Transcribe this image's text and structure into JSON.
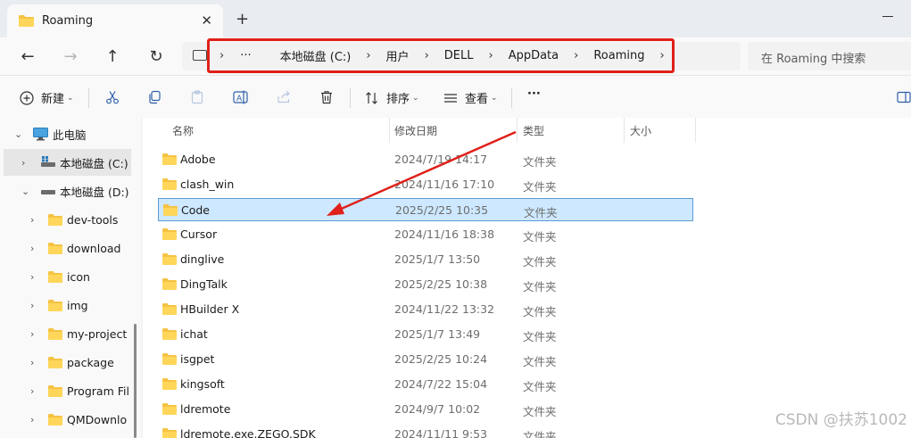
{
  "tab": {
    "title": "Roaming",
    "close": "✕",
    "new_tab": "+"
  },
  "nav": {
    "back": "←",
    "forward": "→",
    "up": "↑",
    "refresh": "↻"
  },
  "breadcrumb": {
    "overflow": "···",
    "items": [
      "本地磁盘 (C:)",
      "用户",
      "DELL",
      "AppData",
      "Roaming"
    ],
    "separator": "›"
  },
  "search": {
    "placeholder": "在 Roaming 中搜索"
  },
  "toolbar": {
    "new_label": "新建",
    "sort_label": "排序",
    "view_label": "查看",
    "more_label": "···"
  },
  "sidebar": {
    "items": [
      {
        "label": "此电脑",
        "icon": "pc-icon"
      },
      {
        "label": "本地磁盘 (C:)",
        "icon": "drive-icon"
      },
      {
        "label": "本地磁盘 (D:)",
        "icon": "drive-icon"
      },
      {
        "label": "dev-tools",
        "icon": "folder-icon"
      },
      {
        "label": "download",
        "icon": "folder-icon"
      },
      {
        "label": "icon",
        "icon": "folder-icon"
      },
      {
        "label": "img",
        "icon": "folder-icon"
      },
      {
        "label": "my-project",
        "icon": "folder-icon"
      },
      {
        "label": "package",
        "icon": "folder-icon"
      },
      {
        "label": "Program Fil",
        "icon": "folder-icon"
      },
      {
        "label": "QMDownlo",
        "icon": "folder-icon"
      }
    ]
  },
  "columns": {
    "name": "名称",
    "date": "修改日期",
    "type": "类型",
    "size": "大小"
  },
  "files": [
    {
      "name": "Adobe",
      "date": "2024/7/19 14:17",
      "type": "文件夹"
    },
    {
      "name": "clash_win",
      "date": "2024/11/16 17:10",
      "type": "文件夹"
    },
    {
      "name": "Code",
      "date": "2025/2/25 10:35",
      "type": "文件夹"
    },
    {
      "name": "Cursor",
      "date": "2024/11/16 18:38",
      "type": "文件夹"
    },
    {
      "name": "dinglive",
      "date": "2025/1/7 13:50",
      "type": "文件夹"
    },
    {
      "name": "DingTalk",
      "date": "2025/2/25 10:38",
      "type": "文件夹"
    },
    {
      "name": "HBuilder X",
      "date": "2024/11/22 13:32",
      "type": "文件夹"
    },
    {
      "name": "ichat",
      "date": "2025/1/7 13:49",
      "type": "文件夹"
    },
    {
      "name": "isgpet",
      "date": "2025/2/25 10:24",
      "type": "文件夹"
    },
    {
      "name": "kingsoft",
      "date": "2024/7/22 15:04",
      "type": "文件夹"
    },
    {
      "name": "ldremote",
      "date": "2024/9/7 10:02",
      "type": "文件夹"
    },
    {
      "name": "ldremote.exe.ZEGO.SDK",
      "date": "2024/11/11 9:53",
      "type": "文件夹"
    }
  ],
  "selected_file": "Code",
  "colors": {
    "folder": "#f5c344",
    "highlight_box": "#e0201a",
    "selection": "#cde8ff"
  },
  "watermark": "CSDN @扶苏1002"
}
